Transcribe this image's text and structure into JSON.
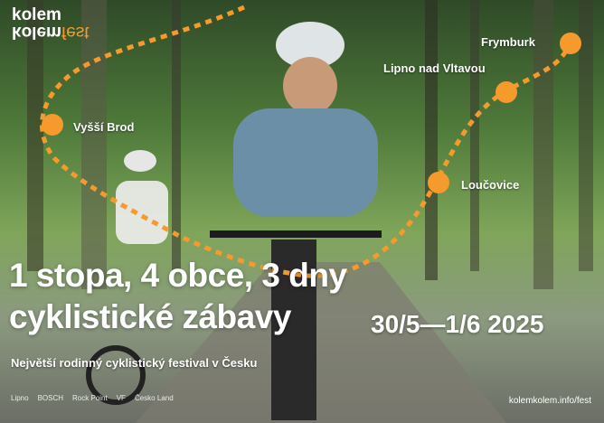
{
  "logo": {
    "line1": "kolem",
    "line2": "kolem",
    "fest": "fest"
  },
  "places": {
    "frymburk": "Frymburk",
    "lipno": "Lipno nad Vltavou",
    "vyssi_brod": "Vyšší Brod",
    "loucovice": "Loučovice"
  },
  "headline": {
    "line1": "1 stopa, 4 obce, 3 dny",
    "line2": "cyklistické zábavy"
  },
  "dates": "30/5—1/6 2025",
  "subtitle": "Největší rodinný cyklistický festival v Česku",
  "sponsors": [
    "Lipno",
    "BOSCH",
    "Rock Point",
    "VF",
    "Česko Land",
    "",
    ""
  ],
  "url": "kolemkolem.info/fest",
  "colors": {
    "accent": "#f59a2b"
  }
}
